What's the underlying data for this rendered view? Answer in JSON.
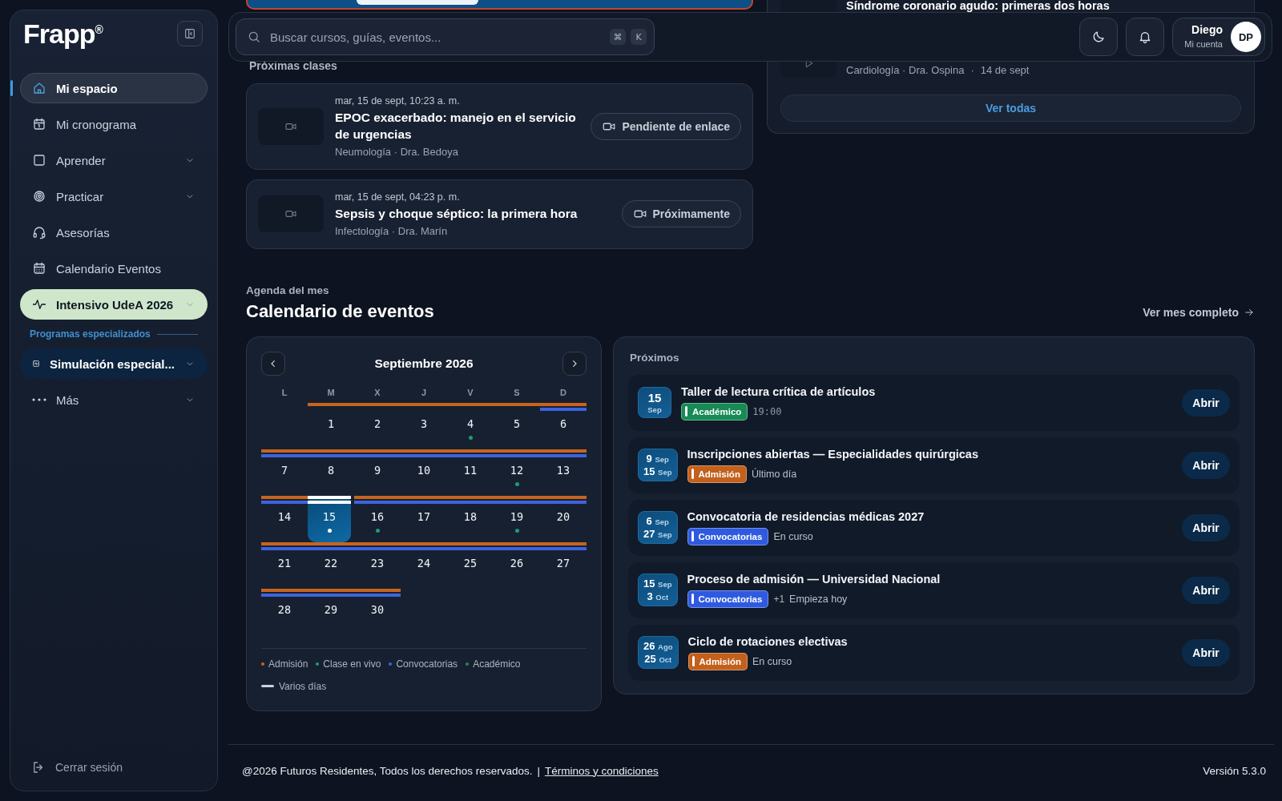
{
  "sidebar": {
    "logo": "Frapp$^{®}$",
    "items": [
      {
        "label": "Mi espacio",
        "kind": "plain",
        "selected": true,
        "expandable": false
      },
      {
        "label": "Mi cronograma",
        "kind": "plain",
        "selected": false,
        "expandable": false
      },
      {
        "label": "Aprender",
        "kind": "plain",
        "selected": false,
        "expandable": true
      },
      {
        "label": "Practicar",
        "kind": "plain",
        "selected": false,
        "expandable": true
      },
      {
        "label": "Asesorías",
        "kind": "plain",
        "selected": false,
        "expandable": false
      },
      {
        "label": "Calendario Eventos",
        "kind": "plain",
        "selected": false,
        "expandable": false
      },
      {
        "label": "Intensivo UdeA 2026",
        "kind": "featured",
        "selected": false,
        "expandable": true
      },
      {
        "label": "Programas especializados",
        "kind": "section"
      },
      {
        "label": "Simulación especial...",
        "kind": "program",
        "selected": false,
        "expandable": true
      },
      {
        "label": "Más",
        "kind": "more",
        "selected": false,
        "expandable": true
      }
    ],
    "logout": "Cerrar sesión"
  },
  "header": {
    "search": {
      "placeholder": "Buscar cursos, guías, eventos..."
    },
    "shortcut": [
      "⌘",
      "K"
    ],
    "user": {
      "name": "Diego",
      "subtitle": "Mi cuenta",
      "initials": "DP"
    }
  },
  "upcoming_classes": {
    "title": "Próximas clases",
    "items": [
      {
        "time": "mar, 15 de sept, 10:23 a. m.",
        "title": "EPOC exacerbado: manejo en el servicio de urgencias",
        "meta": "Neumología · Dra. Bedoya",
        "status": "Pendiente de enlace"
      },
      {
        "time": "mar, 15 de sept, 04:23 p. m.",
        "title": "Sepsis y choque séptico: la primera hora",
        "meta": "Infectología · Dra. Marín",
        "status": "Próximamente"
      }
    ]
  },
  "recorded": {
    "title": "Síndrome coronario agudo: primeras dos horas",
    "meta": "Cardiología · Dra. Ospina",
    "separator": "·",
    "date": "14 de sept",
    "button": "Ver todas"
  },
  "agenda": {
    "eyebrow": "Agenda del mes",
    "title": "Calendario de eventos",
    "link": "Ver mes completo"
  },
  "calendar": {
    "month": "Septiembre 2026",
    "weekdays": [
      "L",
      "M",
      "X",
      "J",
      "V",
      "S",
      "D"
    ],
    "weeks": [
      [
        {
          "kind": "blank"
        },
        {
          "kind": "day",
          "day": "1",
          "admision": true,
          "convocatorias": false,
          "dot": false,
          "selected": false
        },
        {
          "kind": "day",
          "day": "2",
          "admision": true,
          "convocatorias": false,
          "dot": false,
          "selected": false
        },
        {
          "kind": "day",
          "day": "3",
          "admision": true,
          "convocatorias": false,
          "dot": false,
          "selected": false
        },
        {
          "kind": "day",
          "day": "4",
          "admision": true,
          "convocatorias": false,
          "dot": true,
          "selected": false
        },
        {
          "kind": "day",
          "day": "5",
          "admision": true,
          "convocatorias": false,
          "dot": false,
          "selected": false
        },
        {
          "kind": "day",
          "day": "6",
          "admision": true,
          "convocatorias": true,
          "dot": false,
          "selected": false
        }
      ],
      [
        {
          "kind": "day",
          "day": "7",
          "admision": true,
          "convocatorias": true,
          "dot": false,
          "selected": false
        },
        {
          "kind": "day",
          "day": "8",
          "admision": true,
          "convocatorias": true,
          "dot": false,
          "selected": false
        },
        {
          "kind": "day",
          "day": "9",
          "admision": true,
          "convocatorias": true,
          "dot": false,
          "selected": false
        },
        {
          "kind": "day",
          "day": "10",
          "admision": true,
          "convocatorias": true,
          "dot": false,
          "selected": false
        },
        {
          "kind": "day",
          "day": "11",
          "admision": true,
          "convocatorias": true,
          "dot": false,
          "selected": false
        },
        {
          "kind": "day",
          "day": "12",
          "admision": true,
          "convocatorias": true,
          "dot": true,
          "selected": false
        },
        {
          "kind": "day",
          "day": "13",
          "admision": true,
          "convocatorias": true,
          "dot": false,
          "selected": false
        }
      ],
      [
        {
          "kind": "day",
          "day": "14",
          "admision": true,
          "convocatorias": true,
          "dot": false,
          "selected": false
        },
        {
          "kind": "day",
          "day": "15",
          "admision": true,
          "convocatorias": true,
          "dot": true,
          "selected": true
        },
        {
          "kind": "day",
          "day": "16",
          "admision": true,
          "convocatorias": true,
          "dot": true,
          "selected": false
        },
        {
          "kind": "day",
          "day": "17",
          "admision": true,
          "convocatorias": true,
          "dot": false,
          "selected": false
        },
        {
          "kind": "day",
          "day": "18",
          "admision": true,
          "convocatorias": true,
          "dot": false,
          "selected": false
        },
        {
          "kind": "day",
          "day": "19",
          "admision": true,
          "convocatorias": true,
          "dot": true,
          "selected": false
        },
        {
          "kind": "day",
          "day": "20",
          "admision": true,
          "convocatorias": true,
          "dot": false,
          "selected": false
        }
      ],
      [
        {
          "kind": "day",
          "day": "21",
          "admision": true,
          "convocatorias": true,
          "dot": false,
          "selected": false
        },
        {
          "kind": "day",
          "day": "22",
          "admision": true,
          "convocatorias": true,
          "dot": false,
          "selected": false
        },
        {
          "kind": "day",
          "day": "23",
          "admision": true,
          "convocatorias": true,
          "dot": false,
          "selected": false
        },
        {
          "kind": "day",
          "day": "24",
          "admision": true,
          "convocatorias": true,
          "dot": false,
          "selected": false
        },
        {
          "kind": "day",
          "day": "25",
          "admision": true,
          "convocatorias": true,
          "dot": false,
          "selected": false
        },
        {
          "kind": "day",
          "day": "26",
          "admision": true,
          "convocatorias": true,
          "dot": false,
          "selected": false
        },
        {
          "kind": "day",
          "day": "27",
          "admision": true,
          "convocatorias": true,
          "dot": false,
          "selected": false
        }
      ],
      [
        {
          "kind": "day",
          "day": "28",
          "admision": true,
          "convocatorias": true,
          "dot": false,
          "selected": false
        },
        {
          "kind": "day",
          "day": "29",
          "admision": true,
          "convocatorias": true,
          "dot": false,
          "selected": false
        },
        {
          "kind": "day",
          "day": "30",
          "admision": true,
          "convocatorias": true,
          "dot": false,
          "selected": false
        }
      ]
    ],
    "legend": [
      {
        "label": "Admisión",
        "color": "#c8641e"
      },
      {
        "label": "Clase en vivo",
        "color": "#1f9d6b"
      },
      {
        "label": "Convocatorias",
        "color": "#3d63dd"
      },
      {
        "label": "Académico",
        "color": "#1a8a5e"
      }
    ],
    "multi_day": "Varios días"
  },
  "events": {
    "title": "Próximos",
    "items": [
      {
        "dates": [
          {
            "day": "15",
            "month": "Sep"
          }
        ],
        "title": "Taller de lectura crítica de artículos",
        "tag": {
          "label": "Académico",
          "color": "#178a55"
        },
        "note": "19:00",
        "kind": "time",
        "button": "Abrir"
      },
      {
        "dates": [
          {
            "day": "9",
            "month": "Sep"
          },
          {
            "day": "15",
            "month": "Sep"
          }
        ],
        "title": "Inscripciones abiertas — Especialidades quirúrgicas",
        "tag": {
          "label": "Admisión",
          "color": "#c2601c"
        },
        "note": "Último día",
        "kind": "status",
        "button": "Abrir"
      },
      {
        "dates": [
          {
            "day": "6",
            "month": "Sep"
          },
          {
            "day": "27",
            "month": "Sep"
          }
        ],
        "title": "Convocatoria de residencias médicas 2027",
        "tag": {
          "label": "Convocatorias",
          "color": "#2f5ae0"
        },
        "note": "En curso",
        "kind": "status",
        "button": "Abrir"
      },
      {
        "dates": [
          {
            "day": "15",
            "month": "Sep"
          },
          {
            "day": "3",
            "month": "Oct"
          }
        ],
        "title": "Proceso de admisión — Universidad Nacional",
        "tag": {
          "label": "Convocatorias",
          "color": "#2f5ae0"
        },
        "extra": "+1",
        "note": "Empieza hoy",
        "kind": "status",
        "button": "Abrir"
      },
      {
        "dates": [
          {
            "day": "26",
            "month": "Ago"
          },
          {
            "day": "25",
            "month": "Oct"
          }
        ],
        "title": "Ciclo de rotaciones electivas",
        "tag": {
          "label": "Admisión",
          "color": "#c2601c"
        },
        "note": "En curso",
        "kind": "status",
        "button": "Abrir"
      }
    ]
  },
  "footer": {
    "copyright": "@2026 Futuros Residentes, Todos los derechos reservados.",
    "separator": "|",
    "link": "Términos y condiciones",
    "version": "Versión 5.3.0"
  }
}
